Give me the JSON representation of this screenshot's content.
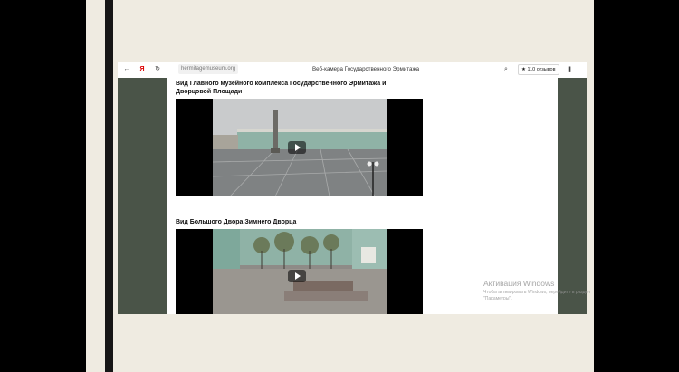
{
  "browser": {
    "url_host": "hermitagemuseum.org",
    "page_title": "Веб-камера Государственного Эрмитажа",
    "reviews_label": "110 отзывов",
    "nav_back_glyph": "←",
    "nav_browser_glyph": "Я",
    "nav_reload_glyph": "↻",
    "search_glyph": "⌕",
    "bookmark_glyph": "▮",
    "star_glyph": "★"
  },
  "cameras": [
    {
      "heading": "Вид Главного музейного комплекса  Государственного Эрмитажа и Дворцовой Площади"
    },
    {
      "heading": "Вид Большого Двора Зимнего Дворца"
    }
  ],
  "watermark": {
    "title": "Активация Windows",
    "subtitle": "Чтобы активировать Windows, перейдите в раздел \"Параметры\"."
  },
  "colors": {
    "slide_bg": "#efebe1",
    "side_panel": "#4a5448",
    "palace_facade": "#8fb2a6"
  }
}
